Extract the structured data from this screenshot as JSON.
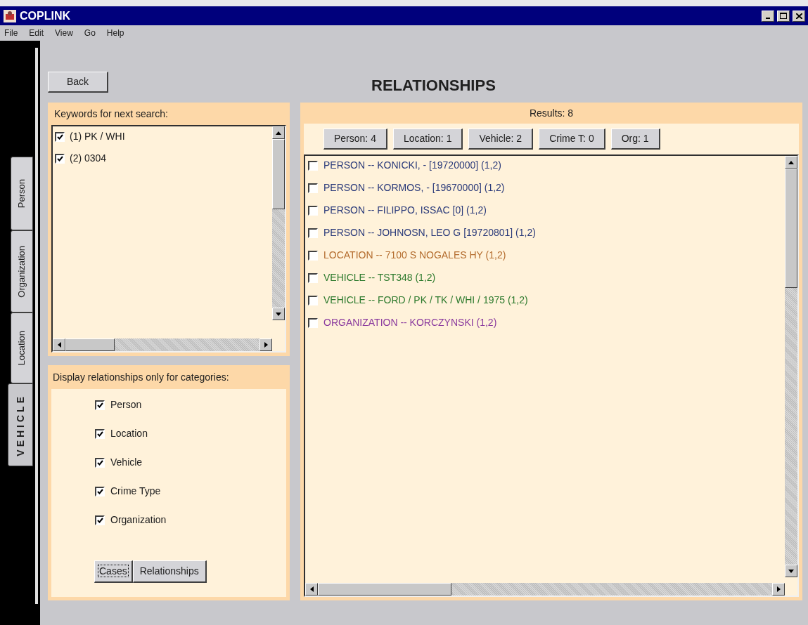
{
  "window": {
    "title": "COPLINK"
  },
  "menu": [
    "File",
    "Edit",
    "View",
    "Go",
    "Help"
  ],
  "side_tabs": [
    {
      "label": "Person",
      "selected": false
    },
    {
      "label": "Organization",
      "selected": false
    },
    {
      "label": "Location",
      "selected": false
    },
    {
      "label": "VEHICLE",
      "selected": true
    }
  ],
  "back_button": "Back",
  "page_title": "RELATIONSHIPS",
  "keywords": {
    "title": "Keywords for next search:",
    "items": [
      {
        "label": "(1) PK / WHI",
        "checked": true
      },
      {
        "label": "(2) 0304",
        "checked": true
      }
    ]
  },
  "categories": {
    "title": "Display relationships only for categories:",
    "items": [
      {
        "label": "Person",
        "checked": true
      },
      {
        "label": "Location",
        "checked": true
      },
      {
        "label": "Vehicle",
        "checked": true
      },
      {
        "label": "Crime Type",
        "checked": true
      },
      {
        "label": "Organization",
        "checked": true
      }
    ],
    "buttons": [
      {
        "label": "Cases",
        "selected": true
      },
      {
        "label": "Relationships",
        "selected": false
      }
    ]
  },
  "results": {
    "title": "Results: 8",
    "filters": [
      "Person: 4",
      "Location: 1",
      "Vehicle: 2",
      "Crime T: 0",
      "Org: 1"
    ],
    "rows": [
      {
        "text": "PERSON -- KONICKI, - [19720000] (1,2)",
        "color": "#2a3a7a",
        "checked": false
      },
      {
        "text": "PERSON -- KORMOS, - [19670000] (1,2)",
        "color": "#2a3a7a",
        "checked": false
      },
      {
        "text": "PERSON -- FILIPPO, ISSAC [0] (1,2)",
        "color": "#2a3a7a",
        "checked": false
      },
      {
        "text": "PERSON -- JOHNOSN, LEO G [19720801] (1,2)",
        "color": "#2a3a7a",
        "checked": false
      },
      {
        "text": "LOCATION -- 7100 S NOGALES HY (1,2)",
        "color": "#b36b2c",
        "checked": false
      },
      {
        "text": "VEHICLE -- TST348 (1,2)",
        "color": "#2d7a2d",
        "checked": false
      },
      {
        "text": "VEHICLE -- FORD / PK / TK / WHI / 1975 (1,2)",
        "color": "#2d7a2d",
        "checked": false
      },
      {
        "text": "ORGANIZATION -- KORCZYNSKI (1,2)",
        "color": "#8a3a9e",
        "checked": false
      }
    ]
  }
}
